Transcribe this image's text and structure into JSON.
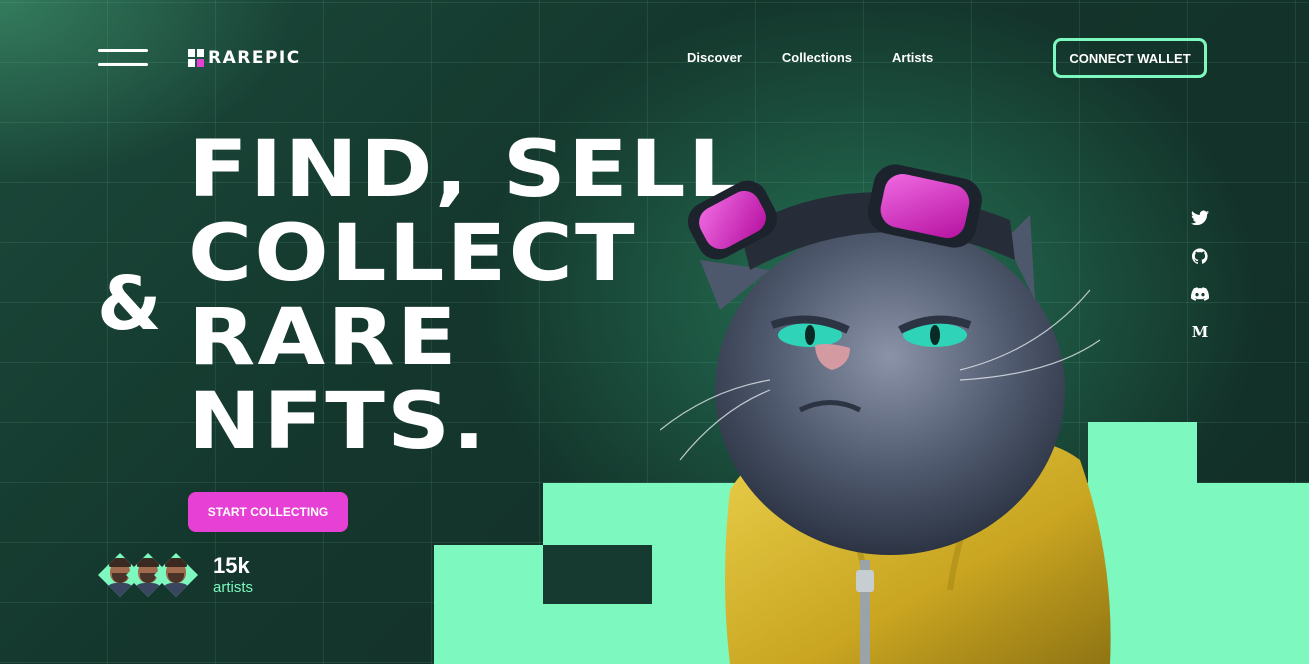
{
  "header": {
    "brand": "RAREPIC",
    "nav": [
      "Discover",
      "Collections",
      "Artists"
    ],
    "connect_label": "CONNECT WALLET"
  },
  "hero": {
    "lines": [
      "FIND, SELL",
      "COLLECT",
      "RARE",
      "NFTS."
    ],
    "ampersand": "&",
    "cta_label": "START COLLECTING",
    "stat_value": "15k",
    "stat_label": "artists"
  },
  "social": [
    "twitter-icon",
    "github-icon",
    "discord-icon",
    "medium-icon"
  ],
  "social_medium_glyph": "M",
  "colors": {
    "mint": "#7df8bf",
    "magenta": "#e640d4",
    "background": "#14362c",
    "jacket": "#d9b82a"
  }
}
